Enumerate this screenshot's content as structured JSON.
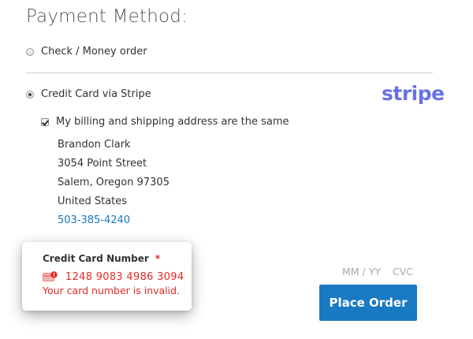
{
  "section_title": "Payment Method:",
  "methods": [
    {
      "label": "Check / Money order",
      "selected": false
    },
    {
      "label": "Credit Card via Stripe",
      "selected": true
    }
  ],
  "stripe_logo_text": "stripe",
  "billing_same": {
    "label": "My billing and shipping address are the same",
    "checked": true
  },
  "address": {
    "name": "Brandon Clark",
    "street": "3054 Point Street",
    "city_state_zip": "Salem, Oregon 97305",
    "country": "United States",
    "phone": "503-385-4240"
  },
  "card": {
    "label": "Credit Card Number",
    "required_mark": "*",
    "number": "1248 9083 4986 3094",
    "error": "Your card number is invalid.",
    "expiry_placeholder": "MM / YY",
    "cvc_placeholder": "CVC"
  },
  "place_order_label": "Place Order",
  "colors": {
    "accent": "#1979c3",
    "error": "#e02b27",
    "stripe": "#6772e5"
  }
}
